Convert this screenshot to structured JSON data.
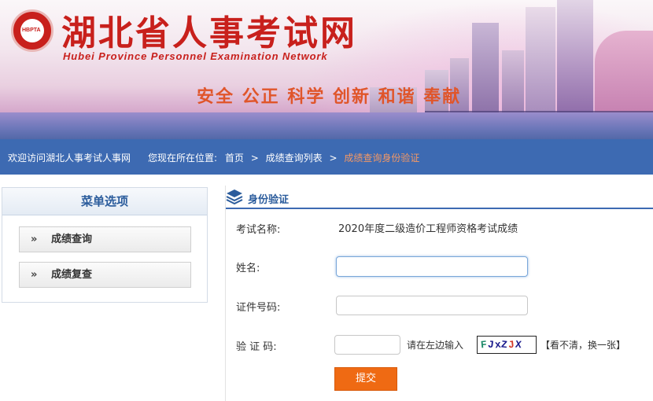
{
  "header": {
    "site_title": "湖北省人事考试网",
    "site_subtitle": "Hubei Province Personnel Examination Network",
    "slogan": "安全  公正  科学  创新  和谐  奉献",
    "logo_text": "HBPTA"
  },
  "nav": {
    "welcome": "欢迎访问湖北人事考试人事网",
    "location_label": "您现在所在位置:",
    "breadcrumbs": [
      "首页",
      "成绩查询列表",
      "成绩查询身份验证"
    ],
    "separator": ">"
  },
  "sidebar": {
    "title": "菜单选项",
    "items": [
      {
        "label": "成绩查询",
        "icon": "double-chevron-right-icon"
      },
      {
        "label": "成绩复查",
        "icon": "double-chevron-right-icon"
      }
    ]
  },
  "form": {
    "panel_title": "身份验证",
    "panel_icon": "layers-icon",
    "exam_name_label": "考试名称:",
    "exam_name_value": "2020年度二级造价工程师资格考试成绩",
    "name_label": "姓名:",
    "name_value": "",
    "id_label": "证件号码:",
    "id_value": "",
    "captcha_label": "验 证 码:",
    "captcha_value": "",
    "captcha_hint": "请在左边输入",
    "captcha_chars": [
      {
        "ch": "F",
        "color": "#1f8a6a"
      },
      {
        "ch": "J",
        "color": "#1a1a8c"
      },
      {
        "ch": "x",
        "color": "#1a1a8c"
      },
      {
        "ch": "Z",
        "color": "#1a1a8c"
      },
      {
        "ch": "J",
        "color": "#d33a2a"
      },
      {
        "ch": "X",
        "color": "#1a1a8c"
      }
    ],
    "refresh_link": "【看不清，换一张】",
    "submit_label": "提交"
  },
  "colors": {
    "brand_red": "#c8201c",
    "nav_blue": "#3d6ab2",
    "breadcrumb_current": "#f39865",
    "submit_orange": "#ef6a13",
    "title_blue": "#2b5c9c"
  }
}
